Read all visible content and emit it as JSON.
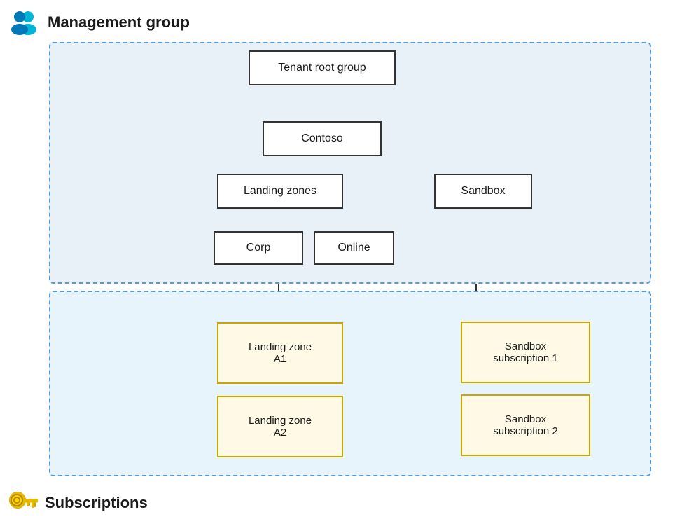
{
  "header": {
    "icon": "users-icon",
    "label": "Management group"
  },
  "footer": {
    "icon": "key-icon",
    "label": "Subscriptions"
  },
  "nodes": {
    "tenant_root": "Tenant root group",
    "contoso": "Contoso",
    "landing_zones": "Landing zones",
    "sandbox": "Sandbox",
    "corp": "Corp",
    "online": "Online",
    "landing_zone_a1": "Landing zone\nA1",
    "landing_zone_a2": "Landing zone\nA2",
    "sandbox_sub1": "Sandbox\nsubscription 1",
    "sandbox_sub2": "Sandbox\nsubscription 2"
  }
}
